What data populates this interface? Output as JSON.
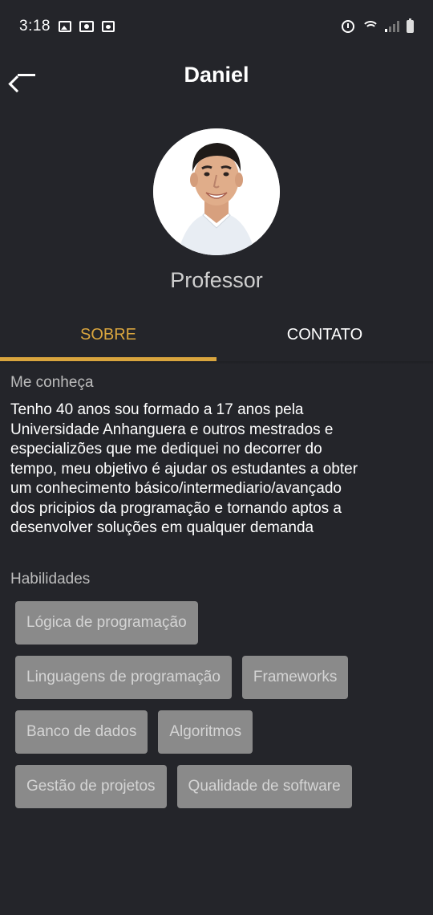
{
  "status_bar": {
    "time": "3:18",
    "left_icons": [
      "image-icon",
      "camera-notification-icon",
      "app-notification-icon"
    ],
    "right_icons": [
      "alarm-icon",
      "wifi-icon",
      "signal-icon",
      "battery-icon"
    ]
  },
  "app_bar": {
    "title": "Daniel",
    "back_icon": "arrow-left-icon"
  },
  "profile": {
    "avatar_icon": "profile-photo",
    "role": "Professor"
  },
  "tabs": [
    {
      "label": "SOBRE",
      "active": true
    },
    {
      "label": "CONTATO",
      "active": false
    }
  ],
  "about": {
    "heading": "Me conheça",
    "lines": [
      "Tenho 40 anos sou formado a 17 anos pela",
      "Universidade Anhanguera e outros mestrados e",
      "especializões que me dediquei no decorrer do",
      "tempo, meu objetivo é ajudar os estudantes a obter",
      "um conhecimento básico/intermediario/avançado",
      "dos pricipios da programação e tornando aptos a",
      "desenvolver soluções em qualquer demanda"
    ]
  },
  "skills": {
    "heading": "Habilidades",
    "rows": [
      [
        "Lógica de programação"
      ],
      [
        "Linguagens de programação",
        "Frameworks"
      ],
      [
        "Banco de dados",
        "Algoritmos"
      ],
      [
        "Gestão de projetos",
        "Qualidade de software"
      ]
    ]
  },
  "colors": {
    "background": "#24252a",
    "accent": "#d9a53e",
    "chip_background": "#8a8a8a",
    "chip_text": "#d4d4d4"
  }
}
